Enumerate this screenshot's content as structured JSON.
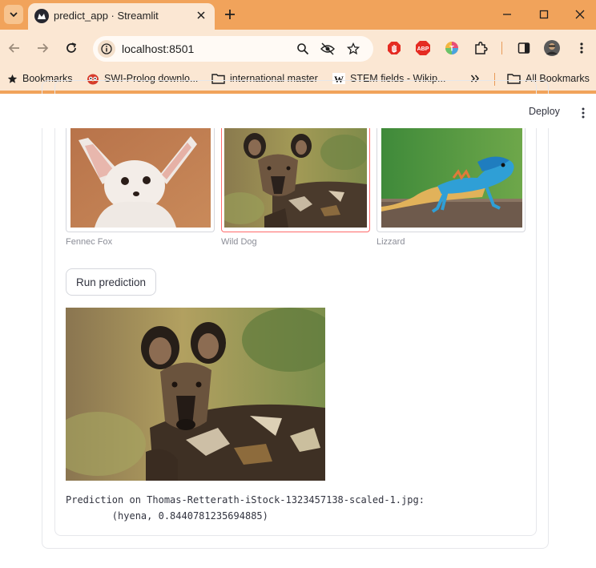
{
  "browser": {
    "tab_title": "predict_app · Streamlit",
    "url": "localhost:8501",
    "bookmarks": [
      {
        "label": "Bookmarks",
        "icon": "star-icon"
      },
      {
        "label": "SWI-Prolog downlo...",
        "icon": "owl-icon"
      },
      {
        "label": "international master",
        "icon": "folder-icon"
      },
      {
        "label": "STEM fields - Wikip...",
        "icon": "wikipedia-icon"
      },
      {
        "label": "All Bookmarks",
        "icon": "folder-icon"
      }
    ],
    "extension_badge": "ABP",
    "colors": {
      "frame": "#f1a35b",
      "toolbar": "#fbe7d3"
    }
  },
  "app": {
    "deploy_label": "Deploy",
    "gallery": [
      {
        "caption": "Fennec Fox",
        "selected": false
      },
      {
        "caption": "Wild Dog",
        "selected": true
      },
      {
        "caption": "Lizzard",
        "selected": false
      }
    ],
    "run_button_label": "Run prediction",
    "prediction_line1": "Prediction on Thomas-Retterath-iStock-1323457138-scaled-1.jpg:",
    "prediction_line2": "        (hyena, 0.8440781235694885)",
    "colors": {
      "selected_border": "#ff6b6b",
      "text": "#31333f",
      "caption": "#8b8d97"
    }
  }
}
